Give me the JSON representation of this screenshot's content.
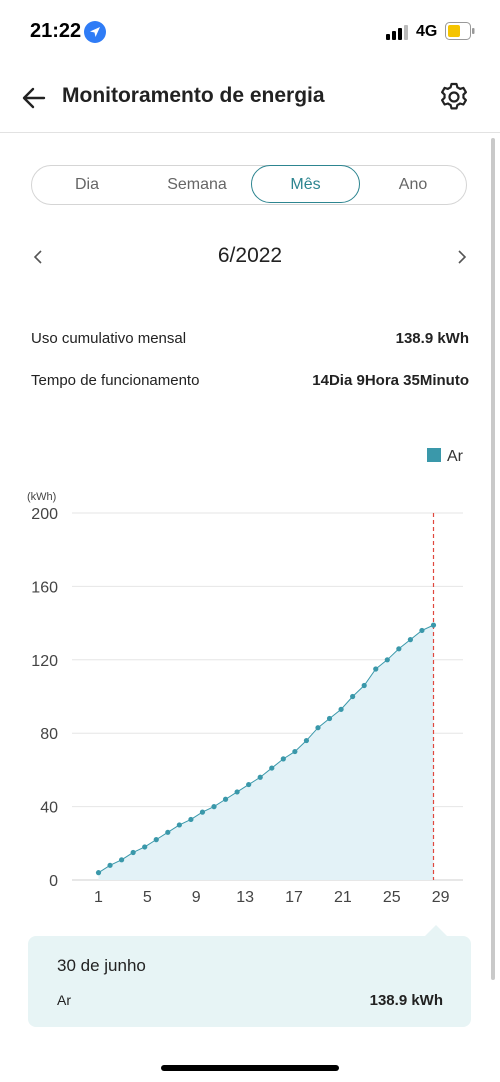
{
  "status_bar": {
    "time": "21:22",
    "network": "4G"
  },
  "header": {
    "title": "Monitoramento de energia"
  },
  "tabs": [
    {
      "label": "Dia",
      "active": false
    },
    {
      "label": "Semana",
      "active": false
    },
    {
      "label": "Mês",
      "active": true
    },
    {
      "label": "Ano",
      "active": false
    }
  ],
  "period": {
    "label": "6/2022"
  },
  "stats": {
    "cumulative_label": "Uso cumulativo mensal",
    "cumulative_value": "138.9 kWh",
    "runtime_label": "Tempo de funcionamento",
    "runtime_value": "14Dia 9Hora 35Minuto"
  },
  "colors": {
    "accent": "#2d8590",
    "series": "#3a98aa",
    "fill": "#e3f2f7",
    "marker_line": "#e0483e",
    "tooltip_bg": "#e7f4f5"
  },
  "chart_data": {
    "type": "area",
    "legend": {
      "label": "Ar",
      "placement": "top-right"
    },
    "unit_label": "(kWh)",
    "ylim": [
      0,
      200
    ],
    "y_ticks": [
      0,
      40,
      80,
      120,
      160,
      200
    ],
    "x_ticks": [
      1,
      5,
      9,
      13,
      17,
      21,
      25,
      29
    ],
    "xlim": [
      0,
      32
    ],
    "grid": true,
    "highlight_x": 30,
    "series": [
      {
        "name": "Ar",
        "x": [
          1,
          2,
          3,
          4,
          5,
          6,
          7,
          8,
          9,
          10,
          11,
          12,
          13,
          14,
          15,
          16,
          17,
          18,
          19,
          20,
          21,
          22,
          23,
          24,
          25,
          26,
          27,
          28,
          29,
          30
        ],
        "values": [
          4,
          8,
          11,
          15,
          18,
          22,
          26,
          30,
          33,
          37,
          40,
          44,
          48,
          52,
          56,
          61,
          66,
          70,
          76,
          83,
          88,
          93,
          100,
          106,
          115,
          120,
          126,
          131,
          136,
          138.9
        ]
      }
    ]
  },
  "tooltip": {
    "date": "30 de junho",
    "series": "Ar",
    "value": "138.9 kWh"
  }
}
